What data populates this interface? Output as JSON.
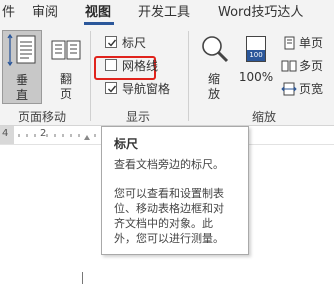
{
  "tabs": [
    "件",
    "审阅",
    "视图",
    "开发工具",
    "Word技巧达人"
  ],
  "active_tab": "视图",
  "ribbon": {
    "page_move_group": {
      "label": "页面移动",
      "vertical_label_1": "垂",
      "vertical_label_2": "直",
      "side_label_1": "翻",
      "side_label_2": "页"
    },
    "show_group": {
      "label": "显示",
      "ruler_label": "标尺",
      "gridlines_label": "网格线",
      "nav_pane_label": "导航窗格",
      "ruler_checked": true,
      "gridlines_checked": false,
      "nav_pane_checked": true
    },
    "zoom_group": {
      "label": "缩放",
      "zoom_label_1": "缩",
      "zoom_label_2": "放",
      "zoom_100_icon_text": "100",
      "zoom_100_label": "100%",
      "one_page_label": "单页",
      "multi_page_label": "多页",
      "page_width_label": "页宽"
    }
  },
  "ruler": {
    "numbers": [
      "4",
      "2"
    ]
  },
  "tooltip": {
    "title": "标尺",
    "line1": "查看文档旁边的标尺。",
    "para2_line1": "您可以查看和设置制表",
    "para2_line2": "位、移动表格边框和对",
    "para2_line3": "齐文档中的对象。此",
    "para2_line4": "外，您可以进行测量。"
  },
  "colors": {
    "accent": "#2b579a",
    "highlight_box": "#e0231c",
    "ribbon_bg": "#f3f3f3"
  }
}
